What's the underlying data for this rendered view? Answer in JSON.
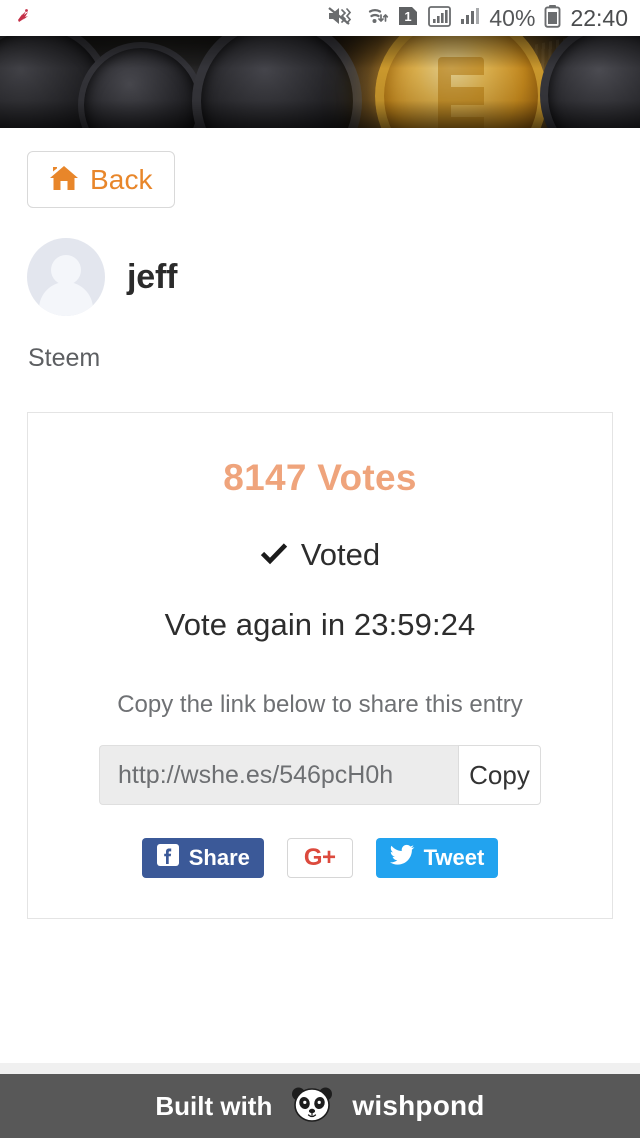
{
  "status_bar": {
    "left_icon": "app-notification-icon",
    "icons": [
      "mute-vibrate-icon",
      "wifi-icon",
      "sim-1-icon",
      "signal-bars-boxed-icon",
      "signal-bars-icon"
    ],
    "battery_percent": "40%",
    "battery_icon": "battery-icon",
    "time": "22:40"
  },
  "hero": {
    "alt": "cryptocurrency-coins-banner"
  },
  "nav": {
    "back_label": "Back",
    "back_icon": "home-icon"
  },
  "profile": {
    "avatar_icon": "default-avatar",
    "username": "jeff",
    "subtitle": "Steem"
  },
  "card": {
    "votes": "8147 Votes",
    "voted_label": "Voted",
    "voted_icon": "check-icon",
    "vote_again": "Vote again in 23:59:24",
    "copy_hint": "Copy the link below to share this entry",
    "share_url": "http://wshe.es/546pcH0h",
    "share_url_placeholder": "http://wshe.es/546pcH0h",
    "copy_button": "Copy",
    "social": [
      {
        "name": "facebook",
        "label": "Share",
        "icon": "facebook-icon",
        "color": "#3b5998"
      },
      {
        "name": "googleplus",
        "label": "G+",
        "icon": "google-plus-icon",
        "color": "#dc4a3d"
      },
      {
        "name": "twitter",
        "label": "Tweet",
        "icon": "twitter-icon",
        "color": "#22a3ef"
      }
    ]
  },
  "footer": {
    "built_with": "Built with",
    "brand": "wishpond",
    "logo_icon": "panda-logo-icon"
  },
  "colors": {
    "accent_orange": "#e8862a",
    "votes_salmon": "#efa47c",
    "footer_bg": "#585858"
  }
}
